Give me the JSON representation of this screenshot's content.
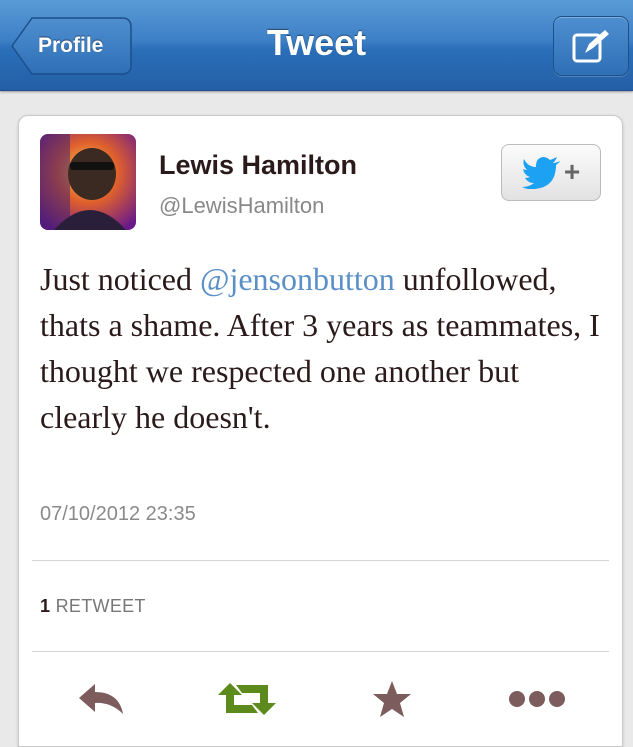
{
  "nav": {
    "title": "Tweet",
    "back_label": "Profile"
  },
  "user": {
    "name": "Lewis Hamilton",
    "handle": "@LewisHamilton"
  },
  "tweet": {
    "text_before": "Just noticed ",
    "mention": "@jensonbutton",
    "text_after": " unfollowed, thats a shame. After 3 years as teammates, I thought we respected one another but clearly he doesn't.",
    "timestamp": "07/10/2012 23:35"
  },
  "stats": {
    "retweet_count": "1",
    "retweet_label": "RETWEET"
  },
  "icons": [
    "compose-icon",
    "twitter-bird-icon",
    "reply-icon",
    "retweet-icon",
    "favorite-star-icon",
    "more-icon"
  ],
  "colors": {
    "nav_blue": "#2a6fb9",
    "mention": "#5b8fc7",
    "retweet_green": "#5d8a1c"
  }
}
